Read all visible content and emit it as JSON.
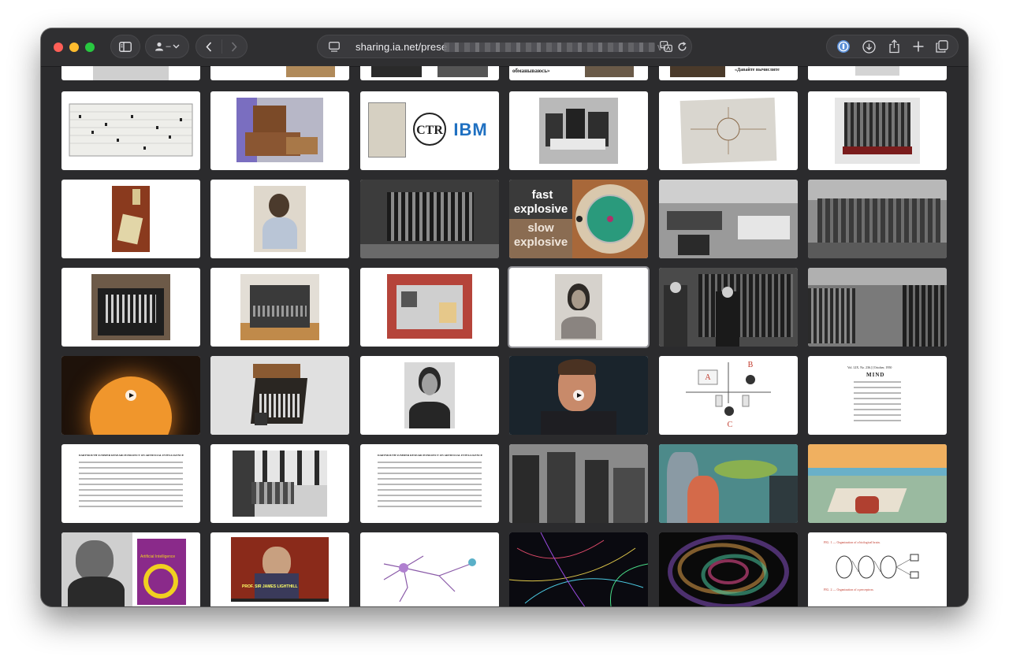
{
  "browser": {
    "url_host": "sharing.ia.net/prese",
    "url_suffix": "vie",
    "profile_dash": "–"
  },
  "slides": {
    "partial_row_texts": [
      "обманываюсь»",
      "«Давайте вычислите"
    ],
    "ibm_logo_text": "IBM",
    "ctr_logo_text": "CTR",
    "fast_label": "fast",
    "explosive_label_1": "explosive",
    "slow_label": "slow",
    "explosive_label_2": "explosive",
    "turing_test_a": "A",
    "turing_test_b": "B",
    "turing_test_c": "C",
    "mind_title": "MIND",
    "mind_header": "Vol. LIX. No. 236.]  [October, 1950",
    "dartmouth_heading": "DARTMOUTH SUMMER RESEARCH PROJECT ON ARTIFICIAL INTELLIGENCE",
    "ai_cover_label": "Artificial Intelligence",
    "lighthill_caption": "PROF. SIR JAMES LIGHTHILL",
    "perceptron_fig_1": "FIG. 1 — Organization of a biological brain.",
    "perceptron_fig_2": "FIG. 2 — Organization of a perceptron."
  },
  "colors": {
    "window_bg": "#2b2b2d",
    "toolbar_bg": "#2f2f31",
    "slide_bg": "#ffffff",
    "close": "#ff5f57",
    "minimize": "#febc2e",
    "maximize": "#28c840"
  },
  "icons": [
    "sidebar-icon",
    "person-icon",
    "chevron-down-icon",
    "back-chevron-icon",
    "forward-chevron-icon",
    "page-icon",
    "translate-icon",
    "reload-icon",
    "password-icon",
    "download-icon",
    "share-icon",
    "plus-icon",
    "tabs-icon"
  ]
}
